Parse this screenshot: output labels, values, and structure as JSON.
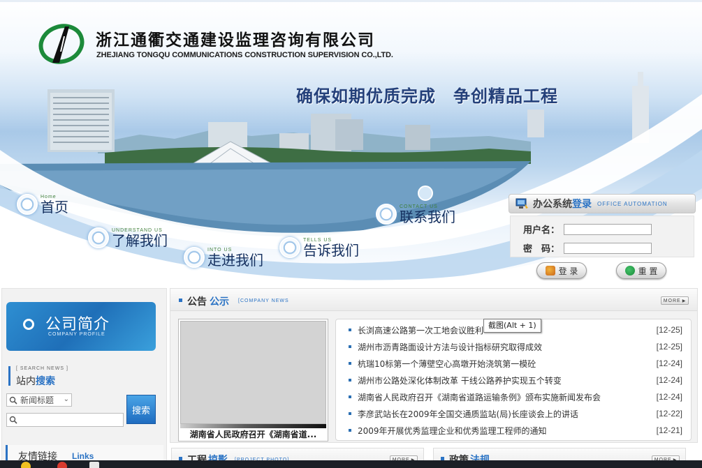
{
  "header": {
    "company_cn": "浙江通衢交通建设监理咨询有限公司",
    "company_en": "ZHEJIANG TONGQU COMMUNICATIONS CONSTRUCTION SUPERVISION CO.,LTD.",
    "slogan": "确保如期优质完成　争创精品工程"
  },
  "nav": {
    "home": {
      "en": "Home",
      "cn": "首页"
    },
    "about": {
      "en": "UNDERSTAND US",
      "cn": "了解我们"
    },
    "into": {
      "en": "INTO US",
      "cn": "走进我们"
    },
    "tell": {
      "en": "TELLS US",
      "cn": "告诉我们"
    },
    "contact": {
      "en": "CONTACT US",
      "cn": "联系我们"
    }
  },
  "login": {
    "title_a": "办公系统",
    "title_b": "登录",
    "title_en": "OFFICE AUTOMATION",
    "username_label": "用户名：",
    "password_label": "密　码：",
    "username_value": "",
    "password_value": "",
    "login_button": "登 录",
    "reset_button": "重 置"
  },
  "sidebar": {
    "profile_cn": "公司简介",
    "profile_en": "COMPANY PROFILE",
    "search_en": "[ SEARCH NEWS ]",
    "search_title_a": "站内",
    "search_title_b": "搜索",
    "search_select_value": "新闻标题",
    "search_input_value": "",
    "search_button": "搜索",
    "links_cn": "友情链接",
    "links_en": "Links"
  },
  "notice": {
    "title_a": "公告",
    "title_b": "公示",
    "title_en": "[COMPANY NEWS",
    "more": "MORE",
    "photo_caption": "湖南省人民政府召开《湖南省道...",
    "items": [
      {
        "title": "长浏高速公路第一次工地会议胜利",
        "date": "[12-25]"
      },
      {
        "title": "湖州市沥青路面设计方法与设计指标研究取得成效",
        "date": "[12-25]"
      },
      {
        "title": "杭瑞10标第一个薄壁空心高墩开始浇筑第一模砼",
        "date": "[12-24]"
      },
      {
        "title": "湖州市公路处深化体制改革 干线公路养护实现五个转变",
        "date": "[12-24]"
      },
      {
        "title": "湖南省人民政府召开《湖南省道路运输条例》颁布实施新闻发布会",
        "date": "[12-24]"
      },
      {
        "title": "李彦武站长在2009年全国交通质监站(局)长座谈会上的讲话",
        "date": "[12-22]"
      },
      {
        "title": "2009年开展优秀监理企业和优秀监理工程师的通知",
        "date": "[12-21]"
      }
    ]
  },
  "tooltip": "截图(Alt + 1)",
  "bottom": {
    "project_title_a": "工程",
    "project_title_b": "掠影",
    "project_en": "[PROJECT PHOTO]",
    "policy_title_a": "政策",
    "policy_title_b": "法规",
    "more": "MORE"
  },
  "colors": {
    "accent": "#2b73c4",
    "brand_green": "#1c8a3a",
    "nav_text": "#15305f"
  }
}
